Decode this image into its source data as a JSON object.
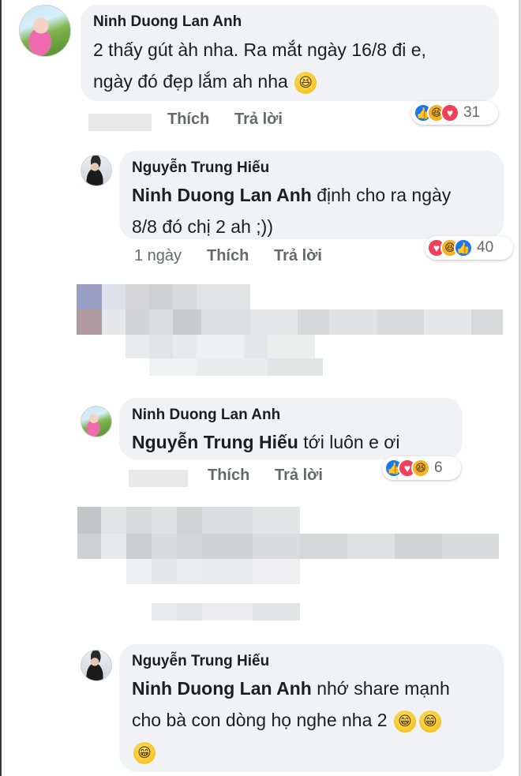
{
  "labels": {
    "like": "Thích",
    "reply": "Trả lời"
  },
  "comments": [
    {
      "author": "Ninh Duong Lan Anh",
      "line1": "2 thấy gút àh nha. Ra mắt ngày 16/8 đi e,",
      "line2": "ngày đó đẹp lắm ah nha",
      "reaction_count": "31"
    },
    {
      "author": "Nguyễn Trung Hiếu",
      "mention": "Ninh Duong Lan Anh",
      "line1_rest": " định cho ra ngày",
      "line2": "8/8 đó chị 2 ah ;))",
      "timestamp": "1 ngày",
      "reaction_count": "40"
    },
    {
      "author": "Ninh Duong Lan Anh",
      "mention": "Nguyễn Trung Hiếu",
      "line1_rest": "  tới luôn e ơi",
      "reaction_count": "6"
    },
    {
      "author": "Nguyễn Trung Hiếu",
      "mention": "Ninh Duong Lan Anh",
      "line1_rest": " nhớ share mạnh",
      "line2": "cho bà con dòng họ nghe nha 2"
    }
  ],
  "emoji_glyphs": {
    "laugh": "😆",
    "grin": "😁",
    "heart": "♥",
    "thumb": "👍"
  },
  "colors": {
    "bubble": "#f0f2f5",
    "like": "#1877f2",
    "love": "#f33e58",
    "haha": "#f7b125",
    "meta_text": "#65676b"
  }
}
